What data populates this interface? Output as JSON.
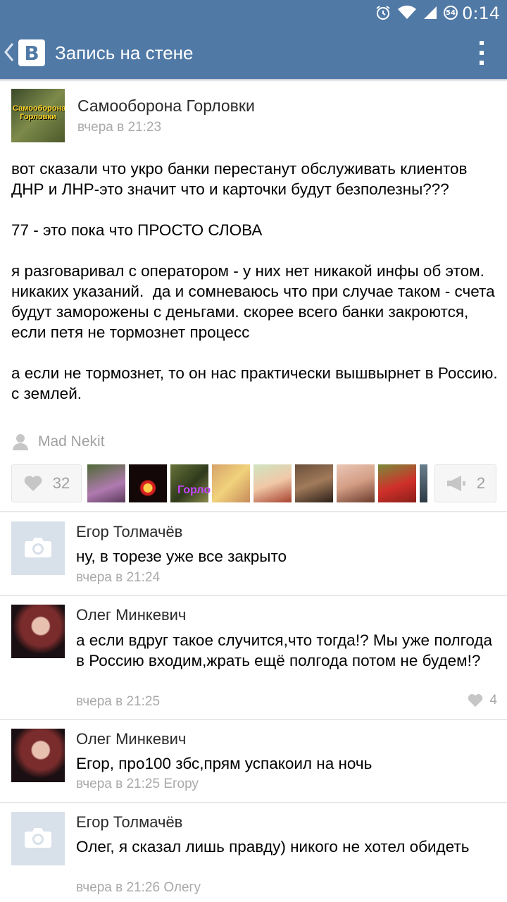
{
  "status_bar": {
    "time": "0:14",
    "battery": "54"
  },
  "header": {
    "title": "Запись на стене",
    "logo": "В"
  },
  "post": {
    "author": "Самооборона Горловки",
    "avatar_label": "Самооборона Горловки",
    "time": "вчера в 21:23",
    "text": "вот сказали что укро банки перестанут обслуживать клиентов ДНР и ЛНР-это значит что и карточки будут безполезны???\n\n77 - это пока что ПРОСТО СЛОВА\n\nя разговаривал с оператором - у них нет никакой инфы об этом. никаких указаний.  да и сомневаюсь что при случае таком - счета будут заморожены с деньгами. скорее всего банки закроются, если петя не тормознет процесс\n\nа если не тормознет, то он нас практически вышвырнет в Россию. с землей.",
    "signer": "Mad Nekit",
    "likes": "32",
    "shares": "2",
    "liker_label": "Горло"
  },
  "comments": [
    {
      "author": "Егор Толмачёв",
      "text": "ну, в торезе уже все закрыто",
      "time": "вчера в 21:24"
    },
    {
      "author": "Олег Минкевич",
      "text": "а если вдруг такое случится,что тогда!? Мы уже полгода в Россию входим,жрать ещё полгода потом не будем!?",
      "time": "вчера в 21:25",
      "likes": "4"
    },
    {
      "author": "Олег Минкевич",
      "text": "Егор, про100 збс,прям успакоил на ночь",
      "time": "вчера в 21:25 Егору"
    },
    {
      "author": "Егор Толмачёв",
      "text": "Олег, я сказал лишь правду) никого не хотел обидеть",
      "time": "вчера в 21:26 Олегу"
    }
  ],
  "icons": {
    "back": "chevron-left-icon",
    "menu": "overflow-menu-icon",
    "like": "heart-icon",
    "share": "megaphone-icon",
    "camera": "camera-icon",
    "person": "person-icon"
  },
  "colors": {
    "bar": "#5079a6",
    "meta": "#a9a9a9"
  }
}
